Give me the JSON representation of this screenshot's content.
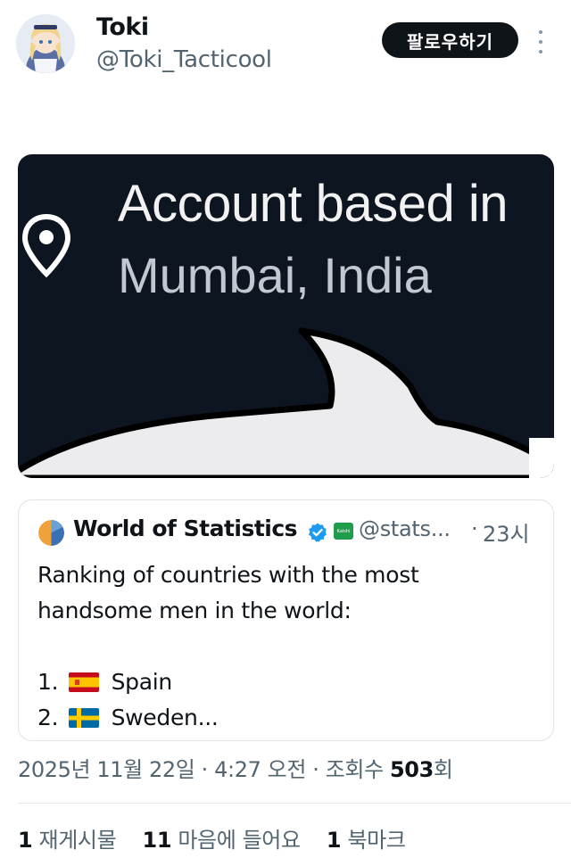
{
  "author": {
    "name": "Toki",
    "handle": "@Toki_Tacticool",
    "follow_label": "팔로우하기"
  },
  "media": {
    "line1": "Account based in",
    "line2": "Mumbai, India",
    "icon": "location-pin-icon"
  },
  "quoted_tweet": {
    "name": "World of Statistics",
    "affiliate_badge_text": "Kalshi",
    "handle": "@stats...",
    "separator": "·",
    "time": "23시",
    "text_line1": "Ranking of countries with the most",
    "text_line2": "handsome men in the world:",
    "list": [
      {
        "num": "1.",
        "flag": "spain-flag-icon",
        "country": "Spain"
      },
      {
        "num": "2.",
        "flag": "sweden-flag-icon",
        "country": "Sweden..."
      }
    ]
  },
  "meta": {
    "datetime": "2025년 11월 22일 · 4:27 오전 · 조회수 ",
    "views": "503",
    "views_suffix": "회"
  },
  "stats": {
    "reposts_count": "1",
    "reposts_label": "재게시물",
    "likes_count": "11",
    "likes_label": "마음에 들어요",
    "bookmarks_count": "1",
    "bookmarks_label": "북마크"
  },
  "colors": {
    "primary_text": "#0f1419",
    "secondary_text": "#536471",
    "follow_button_bg": "#0f1419",
    "media_bg": "#0d1520",
    "verified_blue": "#1d9bf0",
    "affiliate_green": "#1f9d4d"
  }
}
